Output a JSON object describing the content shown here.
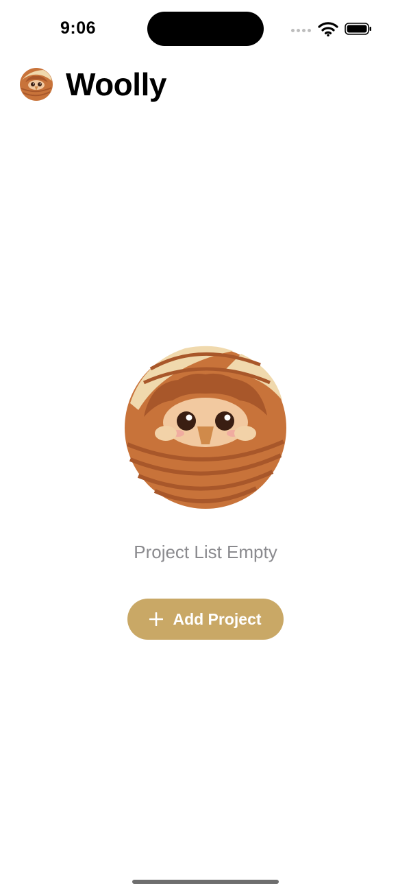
{
  "status_bar": {
    "time": "9:06"
  },
  "app": {
    "title": "Woolly"
  },
  "empty_state": {
    "message": "Project List Empty",
    "add_button_label": "Add Project"
  },
  "icons": {
    "logo": "yarn-ball-mascot-icon",
    "mascot": "yarn-ball-mascot-icon",
    "add": "plus-icon",
    "wifi": "wifi-icon",
    "battery": "battery-icon",
    "signal": "cellular-signal-icon"
  },
  "colors": {
    "accent": "#c9a866",
    "secondary_text": "#8a8a8e",
    "yarn": "#c8733a",
    "yarn_light": "#f0d9ad"
  }
}
